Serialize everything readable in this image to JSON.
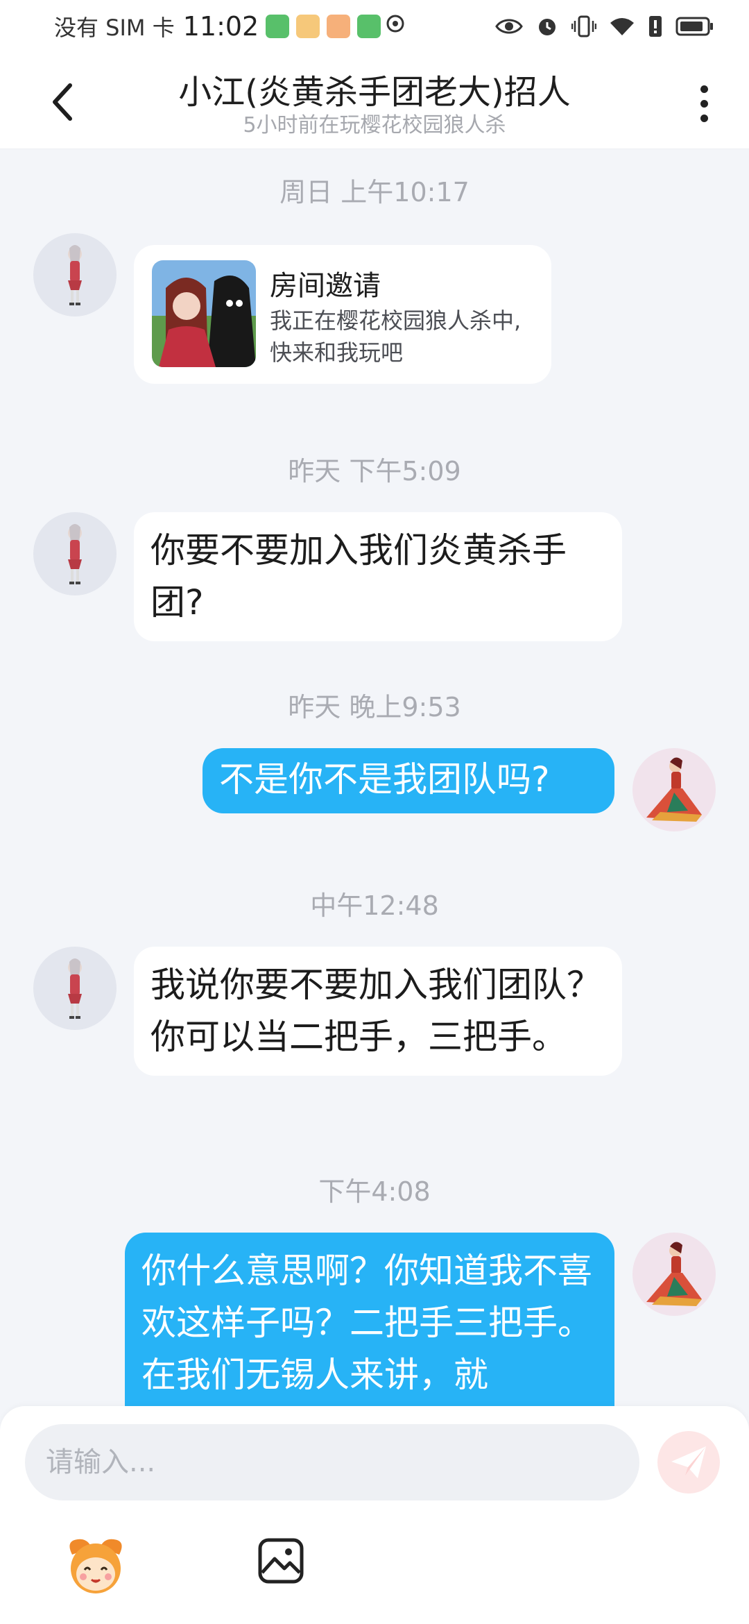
{
  "status_bar": {
    "carrier": "没有 SIM 卡",
    "time": "11:02"
  },
  "header": {
    "title": "小江(炎黄杀手团老大)招人",
    "subtitle": "5小时前在玩樱花校园狼人杀"
  },
  "messages": {
    "t1": "周日 上午10:17",
    "invite": {
      "title": "房间邀请",
      "desc": "我正在樱花校园狼人杀中, 快来和我玩吧"
    },
    "t2": "昨天 下午5:09",
    "m1": "你要不要加入我们炎黄杀手团?",
    "t3": "昨天 晚上9:53",
    "m2": "不是你不是我团队吗?",
    "t4": "中午12:48",
    "m3": "我说你要不要加入我们团队？你可以当二把手，三把手。",
    "t5": "下午4:08",
    "m4": "你什么意思啊？你知道我不喜欢这样子吗？二把手三把手。在我们无锡人来讲，就"
  },
  "input": {
    "placeholder": "请输入..."
  },
  "colors": {
    "accent": "#27b3f6",
    "background": "#f3f5f9",
    "send_button": "#fde6e6"
  },
  "icons": {
    "back": "chevron-left-icon",
    "more": "more-vertical-icon",
    "send": "paper-plane-icon",
    "emoji": "emoji-sticker-icon",
    "image": "image-gallery-icon"
  }
}
